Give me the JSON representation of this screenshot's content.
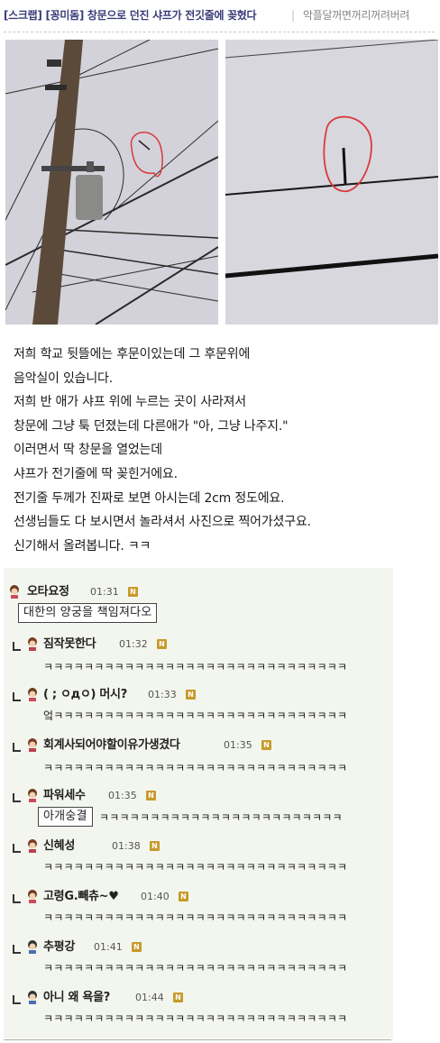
{
  "header": {
    "title": "[스크랩] [꽁미돔] 창문으로 던진 샤프가 전깃줄에 꽂혔다",
    "separator": "|",
    "author": "악플달꺼면꺼리꺼려버려"
  },
  "photos": [
    {
      "name": "photo-utility-pole",
      "content": "utility pole with power lines, circled mechanical pencil"
    },
    {
      "name": "photo-pencil-closeup",
      "content": "close-up of pencil stuck on power line, circled"
    }
  ],
  "body": {
    "lines": [
      "저희 학교 뒷뜰에는 후문이있는데 그 후문위에",
      "음악실이 있습니다.",
      "저희 반 애가 샤프 위에 누르는 곳이 사라져서",
      "창문에 그냥 툭 던졌는데   다른애가 \"아, 그냥 나주지.\"",
      "이러면서 딱 창문을 열었는데",
      "샤프가 전기줄에 딱 꽂힌거에요.",
      "전기줄 두께가 진짜로 보면 아시는데 2cm 정도에요.",
      "선생님들도 다 보시면서 놀라셔서 사진으로 찍어가셨구요.",
      "신기해서 올려봅니다. ㅋㅋ"
    ]
  },
  "comments": [
    {
      "nick": "오타요정",
      "time": "01:31",
      "badge": "N",
      "text": "대한의 양궁을 책임져다오",
      "boxed": true,
      "reply": false
    },
    {
      "nick": "짐작못한다",
      "time": "01:32",
      "badge": "N",
      "text": "ㅋㅋㅋㅋㅋㅋㅋㅋㅋㅋㅋㅋㅋㅋㅋㅋㅋㅋㅋㅋㅋㅋㅋㅋㅋㅋㅋㅋㅋㅋ",
      "boxed": false,
      "reply": true
    },
    {
      "nick": "( ; ㅇдㅇ) 머시?",
      "time": "01:33",
      "badge": "N",
      "text": "엌ㅋㅋㅋㅋㅋㅋㅋㅋㅋㅋㅋㅋㅋㅋㅋㅋㅋㅋㅋㅋㅋㅋㅋㅋㅋㅋㅋㅋㅋ",
      "boxed": false,
      "reply": true
    },
    {
      "nick": "회계사되어야할이유가생겼다",
      "time": "01:35",
      "badge": "N",
      "text": "ㅋㅋㅋㅋㅋㅋㅋㅋㅋㅋㅋㅋㅋㅋㅋㅋㅋㅋㅋㅋㅋㅋㅋㅋㅋㅋㅋㅋㅋㅋ",
      "boxed": false,
      "reply": true
    },
    {
      "nick": "파워세수",
      "time": "01:35",
      "badge": "N",
      "text": "아개숭결",
      "boxed": true,
      "tail": "ㅋㅋㅋㅋㅋㅋㅋㅋㅋㅋㅋㅋㅋㅋㅋㅋㅋㅋㅋㅋㅋㅋㅋㅋ",
      "reply": true
    },
    {
      "nick": "신혜성",
      "time": "01:38",
      "badge": "N",
      "text": "ㅋㅋㅋㅋㅋㅋㅋㅋㅋㅋㅋㅋㅋㅋㅋㅋㅋㅋㅋㅋㅋㅋㅋㅋㅋㅋㅋㅋㅋㅋ",
      "boxed": false,
      "reply": true
    },
    {
      "nick": "고령G.빼츄~♥",
      "time": "01:40",
      "badge": "N",
      "text": "ㅋㅋㅋㅋㅋㅋㅋㅋㅋㅋㅋㅋㅋㅋㅋㅋㅋㅋㅋㅋㅋㅋㅋㅋㅋㅋㅋㅋㅋㅋ",
      "boxed": false,
      "reply": true
    },
    {
      "nick": "추평강",
      "time": "01:41",
      "badge": "N",
      "text": "ㅋㅋㅋㅋㅋㅋㅋㅋㅋㅋㅋㅋㅋㅋㅋㅋㅋㅋㅋㅋㅋㅋㅋㅋㅋㅋㅋㅋㅋㅋ",
      "boxed": false,
      "reply": true
    },
    {
      "nick": "아니 왜 욕을?",
      "time": "01:44",
      "badge": "N",
      "text": "ㅋㅋㅋㅋㅋㅋㅋㅋㅋㅋㅋㅋㅋㅋㅋㅋㅋㅋㅋㅋㅋㅋㅋㅋㅋㅋㅋㅋㅋㅋ",
      "boxed": false,
      "reply": true
    }
  ],
  "colors": {
    "title": "#3b3b7a",
    "circle": "#d83a3a",
    "comment_bg": "#f3f6ee",
    "badge": "#c79a2c"
  }
}
